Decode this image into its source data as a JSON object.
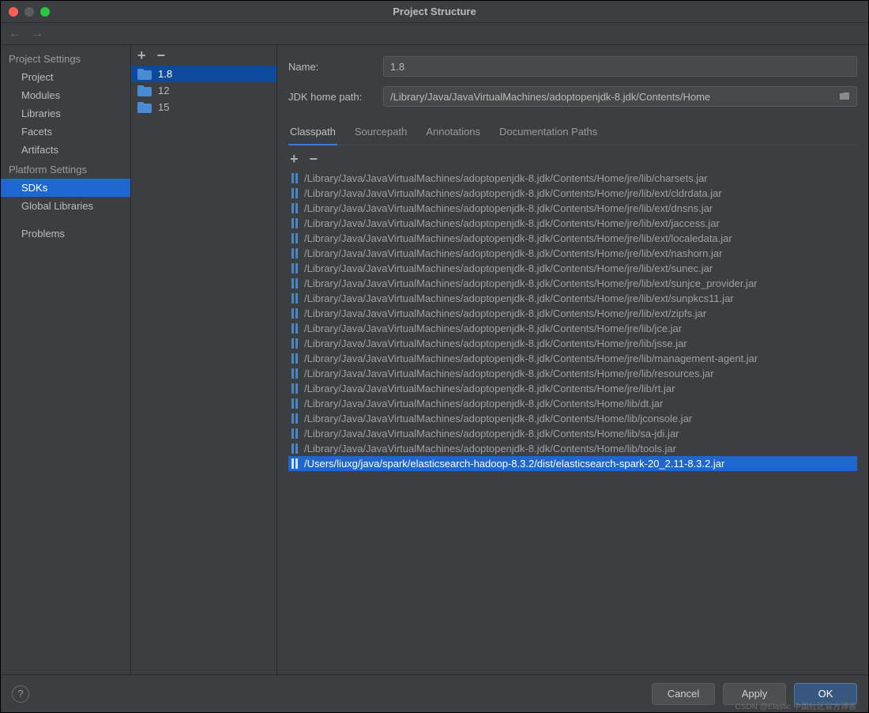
{
  "window": {
    "title": "Project Structure"
  },
  "sidebar": {
    "section1_title": "Project Settings",
    "section1_items": [
      "Project",
      "Modules",
      "Libraries",
      "Facets",
      "Artifacts"
    ],
    "section2_title": "Platform Settings",
    "section2_items": [
      "SDKs",
      "Global Libraries"
    ],
    "section3_items": [
      "Problems"
    ],
    "selected": "SDKs"
  },
  "sdk_list": {
    "items": [
      "1.8",
      "12",
      "15"
    ],
    "selected": "1.8"
  },
  "form": {
    "name_label": "Name:",
    "name_value": "1.8",
    "jdk_label": "JDK home path:",
    "jdk_value": "/Library/Java/JavaVirtualMachines/adoptopenjdk-8.jdk/Contents/Home"
  },
  "tabs": {
    "items": [
      "Classpath",
      "Sourcepath",
      "Annotations",
      "Documentation Paths"
    ],
    "active": "Classpath"
  },
  "classpath": {
    "items": [
      "/Library/Java/JavaVirtualMachines/adoptopenjdk-8.jdk/Contents/Home/jre/lib/charsets.jar",
      "/Library/Java/JavaVirtualMachines/adoptopenjdk-8.jdk/Contents/Home/jre/lib/ext/cldrdata.jar",
      "/Library/Java/JavaVirtualMachines/adoptopenjdk-8.jdk/Contents/Home/jre/lib/ext/dnsns.jar",
      "/Library/Java/JavaVirtualMachines/adoptopenjdk-8.jdk/Contents/Home/jre/lib/ext/jaccess.jar",
      "/Library/Java/JavaVirtualMachines/adoptopenjdk-8.jdk/Contents/Home/jre/lib/ext/localedata.jar",
      "/Library/Java/JavaVirtualMachines/adoptopenjdk-8.jdk/Contents/Home/jre/lib/ext/nashorn.jar",
      "/Library/Java/JavaVirtualMachines/adoptopenjdk-8.jdk/Contents/Home/jre/lib/ext/sunec.jar",
      "/Library/Java/JavaVirtualMachines/adoptopenjdk-8.jdk/Contents/Home/jre/lib/ext/sunjce_provider.jar",
      "/Library/Java/JavaVirtualMachines/adoptopenjdk-8.jdk/Contents/Home/jre/lib/ext/sunpkcs11.jar",
      "/Library/Java/JavaVirtualMachines/adoptopenjdk-8.jdk/Contents/Home/jre/lib/ext/zipfs.jar",
      "/Library/Java/JavaVirtualMachines/adoptopenjdk-8.jdk/Contents/Home/jre/lib/jce.jar",
      "/Library/Java/JavaVirtualMachines/adoptopenjdk-8.jdk/Contents/Home/jre/lib/jsse.jar",
      "/Library/Java/JavaVirtualMachines/adoptopenjdk-8.jdk/Contents/Home/jre/lib/management-agent.jar",
      "/Library/Java/JavaVirtualMachines/adoptopenjdk-8.jdk/Contents/Home/jre/lib/resources.jar",
      "/Library/Java/JavaVirtualMachines/adoptopenjdk-8.jdk/Contents/Home/jre/lib/rt.jar",
      "/Library/Java/JavaVirtualMachines/adoptopenjdk-8.jdk/Contents/Home/lib/dt.jar",
      "/Library/Java/JavaVirtualMachines/adoptopenjdk-8.jdk/Contents/Home/lib/jconsole.jar",
      "/Library/Java/JavaVirtualMachines/adoptopenjdk-8.jdk/Contents/Home/lib/sa-jdi.jar",
      "/Library/Java/JavaVirtualMachines/adoptopenjdk-8.jdk/Contents/Home/lib/tools.jar",
      "/Users/liuxg/java/spark/elasticsearch-hadoop-8.3.2/dist/elasticsearch-spark-20_2.11-8.3.2.jar"
    ],
    "selected_index": 19
  },
  "footer": {
    "cancel": "Cancel",
    "apply": "Apply",
    "ok": "OK"
  },
  "watermark": "CSDN @Elastic 中国社区官方博客"
}
